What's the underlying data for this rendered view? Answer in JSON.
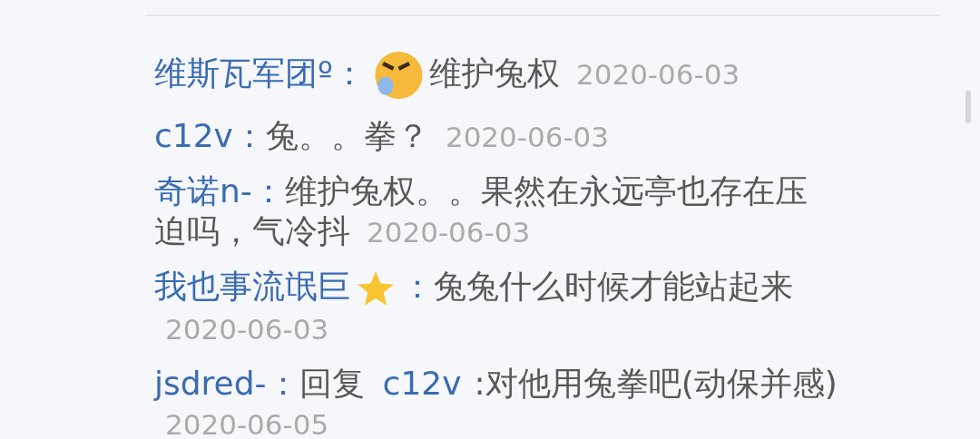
{
  "comments": [
    {
      "segments": [
        {
          "kind": "user",
          "text": "维斯瓦军团º"
        },
        {
          "kind": "sep",
          "text": "："
        },
        {
          "kind": "face"
        },
        {
          "kind": "text",
          "text": "维护兔权"
        },
        {
          "kind": "date",
          "text": "2020-06-03"
        }
      ]
    },
    {
      "segments": [
        {
          "kind": "user",
          "text": "c12v"
        },
        {
          "kind": "sep",
          "text": "："
        },
        {
          "kind": "text",
          "text": "兔。。拳？"
        },
        {
          "kind": "date",
          "text": "2020-06-03"
        }
      ]
    },
    {
      "segments": [
        {
          "kind": "user",
          "text": "奇诺n-"
        },
        {
          "kind": "sep",
          "text": "："
        },
        {
          "kind": "text",
          "text": "维护兔权。。果然在永远亭也存在压"
        },
        {
          "kind": "text",
          "text": "迫吗，气冷抖"
        },
        {
          "kind": "date",
          "text": "2020-06-03"
        }
      ]
    },
    {
      "segments": [
        {
          "kind": "user",
          "text": "我也事流氓巨"
        },
        {
          "kind": "star"
        },
        {
          "kind": "sep",
          "text": "："
        },
        {
          "kind": "text",
          "text": "兔兔什么时候才能站起来"
        },
        {
          "kind": "date",
          "text": "2020-06-03"
        }
      ]
    },
    {
      "segments": [
        {
          "kind": "user",
          "text": "jsdred-"
        },
        {
          "kind": "sep",
          "text": "："
        },
        {
          "kind": "text",
          "text": "回复"
        },
        {
          "kind": "link",
          "text": "c12v"
        },
        {
          "kind": "text",
          "text": ":对他用兔拳吧(动保并感)"
        },
        {
          "kind": "date",
          "text": "2020-06-05"
        }
      ]
    }
  ]
}
